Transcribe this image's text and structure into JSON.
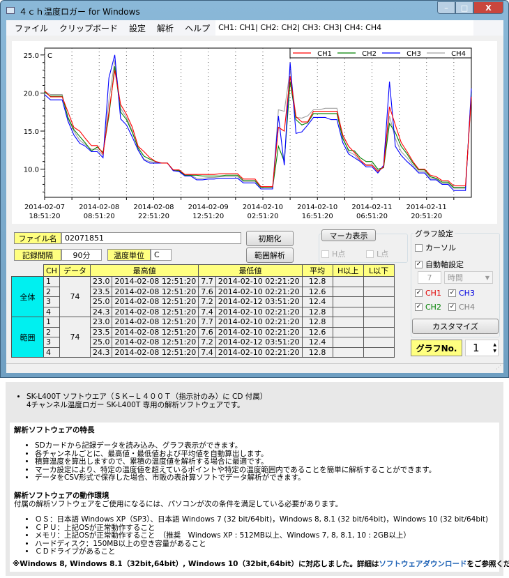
{
  "window": {
    "title": "４ｃｈ温度ロガー for Windows",
    "controls": {
      "minimize": "–",
      "maximize": "□",
      "close": "X"
    }
  },
  "menu": {
    "items": [
      "ファイル",
      "クリップボード",
      "設定",
      "解析",
      "ヘルプ"
    ],
    "channel_status": "CH1: CH1| CH2: CH2| CH3: CH3| CH4: CH4"
  },
  "chart_data": {
    "type": "line",
    "ylabel": "C",
    "ylim": [
      6.3,
      25.9
    ],
    "yticks": [
      "10.0",
      "15.0",
      "20.0",
      "25.0"
    ],
    "ytick_values": [
      10,
      15,
      20,
      25
    ],
    "xticks": [
      [
        "2014-02-07",
        "18:51:20"
      ],
      [
        "2014-02-08",
        "08:51:20"
      ],
      [
        "2014-02-08",
        "22:51:20"
      ],
      [
        "2014-02-09",
        "12:51:20"
      ],
      [
        "2014-02-10",
        "02:51:20"
      ],
      [
        "2014-02-10",
        "16:51:20"
      ],
      [
        "2014-02-11",
        "06:51:20"
      ],
      [
        "2014-02-11",
        "20:51:20"
      ]
    ],
    "x_start": "2014-02-07 18:51:20",
    "interval_minutes": 90,
    "grid": "vertical dotted",
    "legend": "top-right",
    "series": [
      {
        "name": "CH1",
        "color": "#ff0000",
        "values": [
          20.3,
          19.5,
          19.5,
          19.5,
          17.5,
          15.5,
          15.0,
          14.0,
          13.1,
          13.1,
          12.0,
          17.5,
          23.0,
          18.5,
          17.2,
          15.5,
          13.0,
          12.3,
          11.5,
          11.0,
          10.8,
          10.8,
          9.9,
          9.9,
          9.3,
          9.3,
          9.3,
          9.3,
          9.3,
          9.3,
          9.4,
          9.4,
          9.4,
          9.4,
          8.7,
          8.7,
          8.7,
          7.7,
          7.7,
          7.7,
          15.5,
          15.0,
          22.2,
          16.9,
          16.2,
          16.2,
          17.6,
          17.6,
          17.6,
          17.6,
          17.6,
          14.5,
          13.0,
          12.2,
          11.2,
          10.5,
          10.5,
          9.7,
          10.3,
          18.2,
          15.8,
          13.5,
          12.3,
          11.0,
          10.0,
          10.0,
          9.2,
          9.0,
          8.5,
          8.5,
          7.8,
          7.8,
          7.8,
          19.5
        ]
      },
      {
        "name": "CH2",
        "color": "#008000",
        "values": [
          20.1,
          19.6,
          19.6,
          19.6,
          16.8,
          15.2,
          14.3,
          13.4,
          12.4,
          12.9,
          12.2,
          17.0,
          23.5,
          17.5,
          16.5,
          14.8,
          12.8,
          11.7,
          11.3,
          11.0,
          10.8,
          10.8,
          9.9,
          9.8,
          9.2,
          9.2,
          9.2,
          9.1,
          9.1,
          9.1,
          9.1,
          9.2,
          9.2,
          9.2,
          8.5,
          8.5,
          8.5,
          7.6,
          7.6,
          7.6,
          13.0,
          11.0,
          21.5,
          16.5,
          15.8,
          16.1,
          17.3,
          17.3,
          17.3,
          17.3,
          17.3,
          14.0,
          12.5,
          12.4,
          11.5,
          11.0,
          11.0,
          10.0,
          10.2,
          16.0,
          14.8,
          13.0,
          12.0,
          10.8,
          9.9,
          9.9,
          9.0,
          8.8,
          8.3,
          8.3,
          7.6,
          7.6,
          7.6,
          20.0
        ]
      },
      {
        "name": "CH3",
        "color": "#0000ff",
        "values": [
          19.8,
          19.1,
          19.1,
          19.1,
          16.3,
          14.5,
          13.4,
          13.0,
          12.3,
          12.3,
          11.5,
          22.0,
          25.0,
          16.6,
          15.8,
          14.2,
          12.5,
          11.2,
          10.8,
          10.8,
          10.8,
          10.8,
          9.8,
          9.7,
          9.1,
          9.1,
          8.6,
          8.6,
          8.7,
          8.7,
          8.8,
          8.8,
          8.8,
          8.8,
          8.2,
          8.2,
          8.2,
          7.4,
          7.4,
          7.4,
          17.0,
          10.5,
          24.0,
          14.7,
          14.9,
          15.8,
          16.8,
          16.8,
          16.8,
          16.5,
          16.5,
          13.5,
          12.0,
          11.5,
          11.0,
          10.3,
          10.3,
          9.5,
          10.5,
          21.5,
          13.0,
          11.8,
          11.0,
          10.3,
          9.5,
          9.5,
          8.6,
          8.6,
          8.0,
          8.0,
          7.2,
          7.2,
          7.2,
          20.6
        ]
      },
      {
        "name": "CH4",
        "color": "#a0a0a0",
        "values": [
          20.2,
          19.8,
          19.8,
          19.8,
          16.6,
          15.0,
          13.8,
          13.2,
          12.6,
          12.6,
          11.8,
          19.0,
          24.3,
          18.0,
          16.8,
          15.0,
          12.6,
          11.3,
          11.0,
          10.9,
          10.8,
          10.8,
          9.9,
          9.8,
          9.2,
          9.2,
          8.8,
          8.8,
          8.9,
          8.9,
          9.0,
          9.0,
          9.0,
          9.0,
          8.4,
          8.4,
          8.4,
          7.4,
          7.4,
          7.4,
          17.8,
          17.6,
          23.0,
          16.8,
          16.7,
          17.0,
          17.8,
          17.8,
          18.0,
          18.0,
          18.0,
          14.3,
          12.3,
          11.9,
          11.0,
          10.6,
          10.6,
          9.8,
          10.2,
          17.0,
          14.0,
          12.3,
          11.5,
          10.5,
          9.7,
          9.7,
          8.8,
          8.7,
          8.1,
          8.1,
          7.5,
          7.5,
          7.5,
          20.0
        ]
      }
    ]
  },
  "fileinfo": {
    "file_label": "ファイル名",
    "file_value": "02071851",
    "interval_label": "記録間隔",
    "interval_value": "90分",
    "unit_label": "温度単位",
    "unit_value": "C"
  },
  "buttons": {
    "init": "初期化",
    "range": "範囲解析",
    "customize": "カスタマイズ"
  },
  "marker": {
    "title": "マーカ表示",
    "h": "H点",
    "l": "L点"
  },
  "graph_settings": {
    "title": "グラフ設定",
    "cursor": "カーソル",
    "auto_axis": "自動軸設定",
    "span_value": "7",
    "span_unit": "時間",
    "channels": [
      {
        "label": "CH1",
        "color": "#e00000",
        "checked": true
      },
      {
        "label": "CH3",
        "color": "#0000e0",
        "checked": true
      },
      {
        "label": "CH2",
        "color": "#008000",
        "checked": true
      },
      {
        "label": "CH4",
        "color": "#808080",
        "checked": true
      }
    ],
    "check": "✓",
    "graph_no_label": "グラフNo.",
    "graph_no": "1"
  },
  "table": {
    "headers": [
      "CH",
      "データ",
      "最高値",
      "最低値",
      "平均",
      "H以上",
      "L以下"
    ],
    "groups": [
      {
        "label": "全体",
        "count": "74",
        "rows": [
          [
            "1",
            "23.0",
            "2014-02-08 12:51:20",
            "7.7",
            "2014-02-10 02:21:20",
            "12.8"
          ],
          [
            "2",
            "23.5",
            "2014-02-08 12:51:20",
            "7.6",
            "2014-02-10 02:21:20",
            "12.6"
          ],
          [
            "3",
            "25.0",
            "2014-02-08 12:51:20",
            "7.2",
            "2014-02-12 03:51:20",
            "12.4"
          ],
          [
            "4",
            "24.3",
            "2014-02-08 12:51:20",
            "7.4",
            "2014-02-10 02:21:20",
            "12.8"
          ]
        ]
      },
      {
        "label": "範囲",
        "count": "74",
        "rows": [
          [
            "1",
            "23.0",
            "2014-02-08 12:51:20",
            "7.7",
            "2014-02-10 02:21:20",
            "12.8"
          ],
          [
            "2",
            "23.5",
            "2014-02-08 12:51:20",
            "7.6",
            "2014-02-10 02:21:20",
            "12.6"
          ],
          [
            "3",
            "25.0",
            "2014-02-08 12:51:20",
            "7.2",
            "2014-02-12 03:51:20",
            "12.4"
          ],
          [
            "4",
            "24.3",
            "2014-02-08 12:51:20",
            "7.4",
            "2014-02-10 02:21:20",
            "12.8"
          ]
        ]
      }
    ]
  },
  "web": {
    "intro_1": "SK-L400T ソフトウエア（ＳＫ−Ｌ４００Ｔ（指示計のみ）に CD 付属）",
    "intro_2": "4チャンネル温度ロガー SK-L400T 専用の解析ソフトウェアです。",
    "features_title": "解析ソフトウェアの特長",
    "features": [
      "SDカードから記録データを読み込み、グラフ表示ができます。",
      "各チャンネルごとに、最高値・最低値および平均値を自動算出します。",
      "積算温度を算出しますので、累積の温度値を解析する場合に最適です。",
      "マーカ設定により、特定の温度値を超えているポイントや特定の温度範囲内であることを簡単に解析することができます。",
      "データをCSV形式で保存した場合、市販の表計算ソフトでデータ解析ができます。"
    ],
    "env_title": "解析ソフトウェアの動作環境",
    "env_intro": "付属の解析ソフトウェアをご使用になるには、パソコンが次の条件を満足している必要があります。",
    "env": [
      "ＯＳ：日本語 Windows XP（SP3）、日本語 Windows 7 (32 bit/64bit)，Windows 8, 8.1 (32 bit/64bit)，Windows 10 (32 bit/64bit)",
      "ＣＰＵ：上記OSが正常動作すること",
      "メモリ：上記OSが正常動作すること　（推奨　Windows XP : 512MB以上、Windows 7, 8, 8.1, 10 : 2GB以上）",
      "ハードディスク：150MB以上の空き容量があること",
      "ＣＤドライブがあること"
    ],
    "note_pre": "※Windows 8, Windows 8.1（32bit,64bit）, Windows 10（32bit,64bit）に対応しました。詳細は",
    "note_link": "ソフトウェアダウンロード",
    "note_post": "をご参照ください。"
  }
}
